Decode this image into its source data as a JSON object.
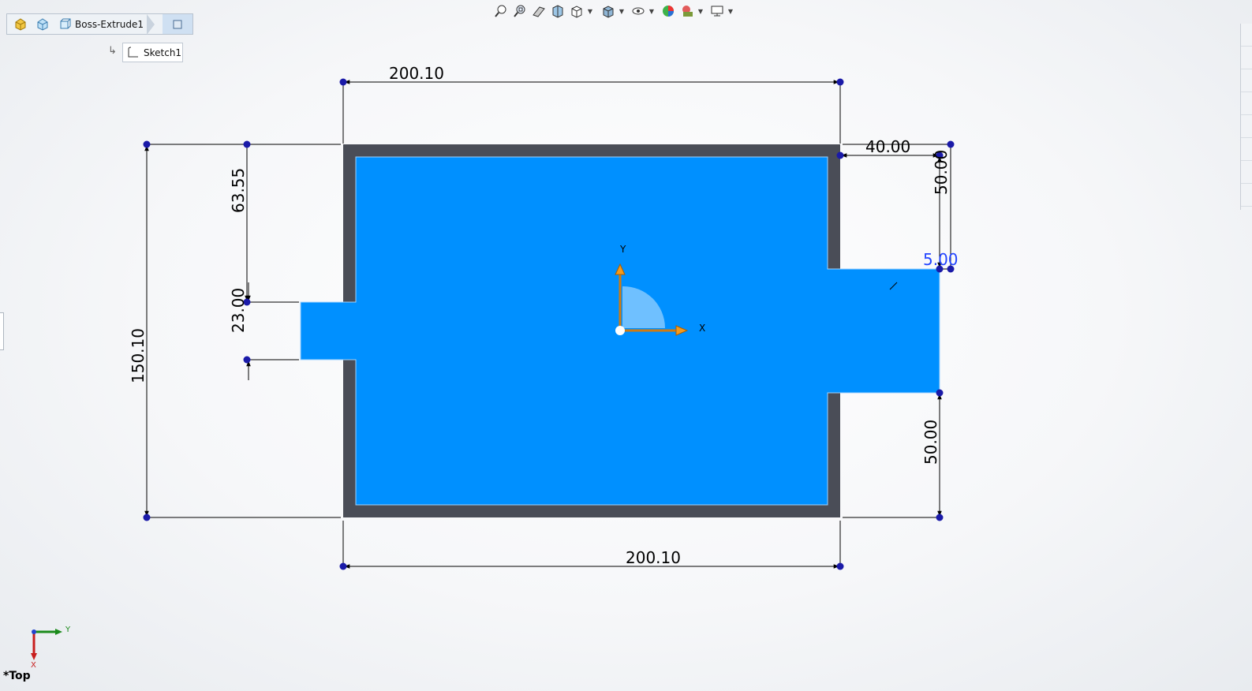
{
  "breadcrumb": {
    "feature_label": "Boss-Extrude1",
    "sketch_label": "Sketch1"
  },
  "toolbar": {
    "icons": [
      "zoom-to-fit-icon",
      "zoom-to-area-icon",
      "previous-view-icon",
      "section-view-icon",
      "view-orientation-icon",
      "display-style-icon",
      "hide-show-items-icon",
      "edit-appearance-icon",
      "apply-scene-icon",
      "view-settings-icon"
    ]
  },
  "dimensions": {
    "top_width": "200.10",
    "bottom_width": "200.10",
    "overall_height": "150.10",
    "left_offset": "63.55",
    "left_tab_height": "23.00",
    "right_tab_width": "40.00",
    "right_top_offset": "50.00",
    "right_tab_gap": "5.00",
    "right_bottom_offset": "50.00"
  },
  "origin_axes": {
    "x_label": "X",
    "y_label": "Y"
  },
  "triad": {
    "x_label": "X",
    "y_label": "Y"
  },
  "view_name": "*Top",
  "colors": {
    "sketch_fill": "#0090ff",
    "border": "#4a4d57",
    "dimension_point": "#1a1aa8",
    "selected_dimension": "#2244ff",
    "axis_arrow": "#f59a1b"
  }
}
